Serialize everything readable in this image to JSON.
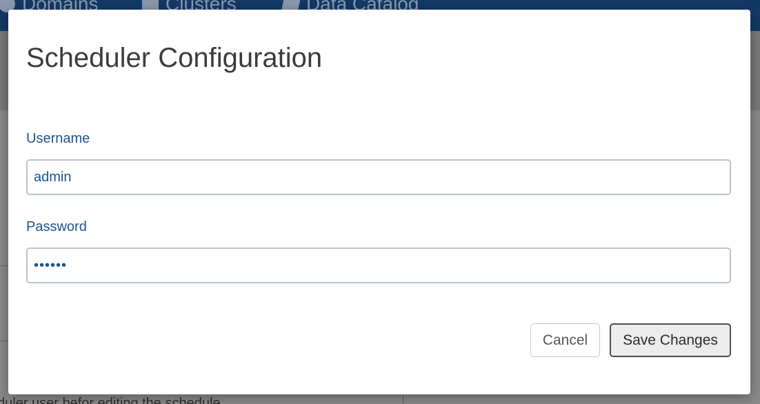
{
  "background": {
    "nav_items": [
      {
        "label": "Domains",
        "icon": "globe-icon"
      },
      {
        "label": "Clusters",
        "icon": "server-icon"
      },
      {
        "label": "Data Catalog",
        "icon": "book-icon"
      }
    ],
    "body_text": "duler user befor editing the schedule"
  },
  "modal": {
    "title": "Scheduler Configuration",
    "username_label": "Username",
    "username_value": "admin",
    "password_label": "Password",
    "password_value": "••••••",
    "cancel_label": "Cancel",
    "save_label": "Save Changes"
  },
  "colors": {
    "nav_background": "#123a66",
    "label_text": "#1a5392",
    "overlay": "#7f7f7f"
  }
}
